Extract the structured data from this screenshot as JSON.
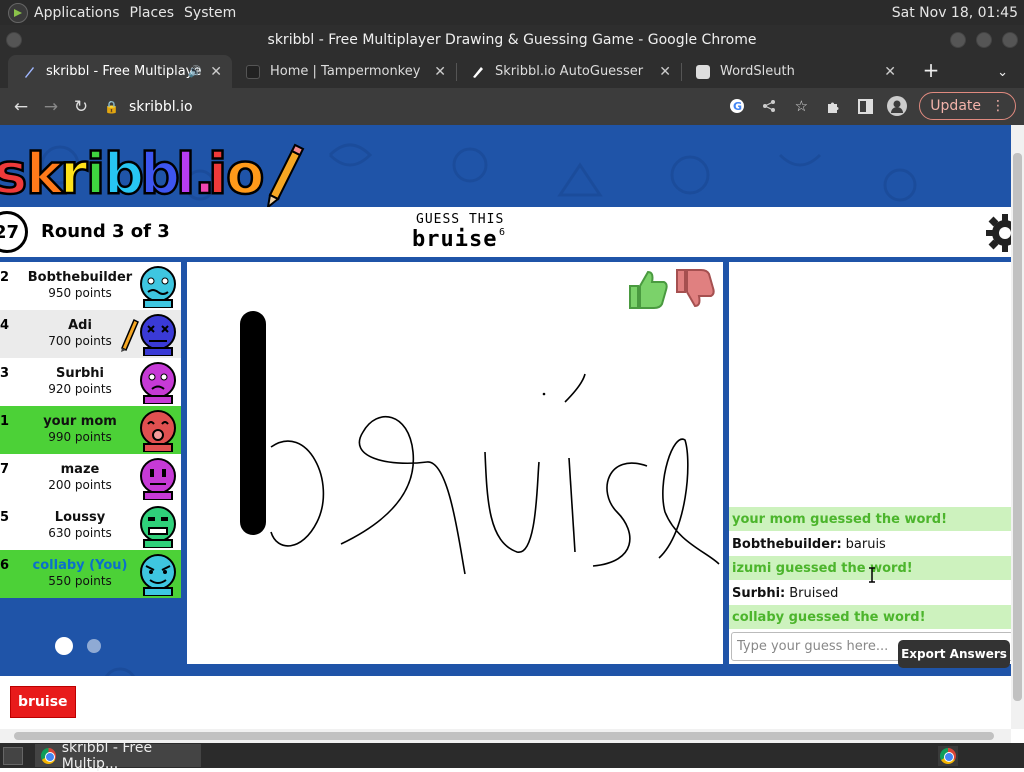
{
  "os": {
    "menus": [
      "Applications",
      "Places",
      "System"
    ],
    "clock": "Sat Nov 18, 01:45"
  },
  "window": {
    "title": "skribbl - Free Multiplayer Drawing & Guessing Game - Google Chrome"
  },
  "tabs": [
    {
      "label": "skribbl - Free Multiplaye",
      "icon": "skribbl-favicon",
      "active": true
    },
    {
      "label": "Home | Tampermonkey",
      "icon": "tampermonkey-favicon"
    },
    {
      "label": "Skribbl.io AutoGuesser",
      "icon": "pen-favicon"
    },
    {
      "label": "WordSleuth",
      "icon": "book-favicon"
    }
  ],
  "toolbar": {
    "url": "skribbl.io",
    "update_label": "Update"
  },
  "game": {
    "timer": "27",
    "round": "Round 3 of 3",
    "guess_label": "GUESS THIS",
    "word": "bruise",
    "word_length": "6"
  },
  "players": [
    {
      "rank": "2",
      "name": "Bobthebuilder",
      "points": "950 points",
      "avatar_color": "#3ec6e0"
    },
    {
      "rank": "4",
      "name": "Adi",
      "points": "700 points",
      "avatar_color": "#3a3ad6",
      "drawing": true
    },
    {
      "rank": "3",
      "name": "Surbhi",
      "points": "920 points",
      "avatar_color": "#c63ad6"
    },
    {
      "rank": "1",
      "name": "your mom",
      "points": "990 points",
      "avatar_color": "#e05050"
    },
    {
      "rank": "7",
      "name": "maze",
      "points": "200 points",
      "avatar_color": "#c63ad6"
    },
    {
      "rank": "5",
      "name": "Loussy",
      "points": "630 points",
      "avatar_color": "#2fd17a"
    },
    {
      "rank": "6",
      "name": "collaby (You)",
      "points": "550 points",
      "avatar_color": "#3ec6e0"
    }
  ],
  "chat": {
    "messages": [
      {
        "text": "your mom guessed the word!",
        "type": "green"
      },
      {
        "who": "Bobthebuilder:",
        "text": "baruis",
        "type": "normal"
      },
      {
        "text": "izumi guessed the word!",
        "type": "green"
      },
      {
        "who": "Surbhi:",
        "text": "Bruised",
        "type": "normal"
      },
      {
        "text": "collaby guessed the word!",
        "type": "green"
      }
    ],
    "placeholder": "Type your guess here...",
    "export_label": "Export Answers"
  },
  "answer_chip": "bruise",
  "taskbar": {
    "task_label": "skribbl - Free Multip..."
  },
  "colors": {
    "background_blue": "#1f54a8",
    "winner_green": "#4cd137",
    "chat_green_bg": "#cdf2be",
    "chat_green_text": "#4cb52c",
    "answer_red": "#e81b1b"
  }
}
